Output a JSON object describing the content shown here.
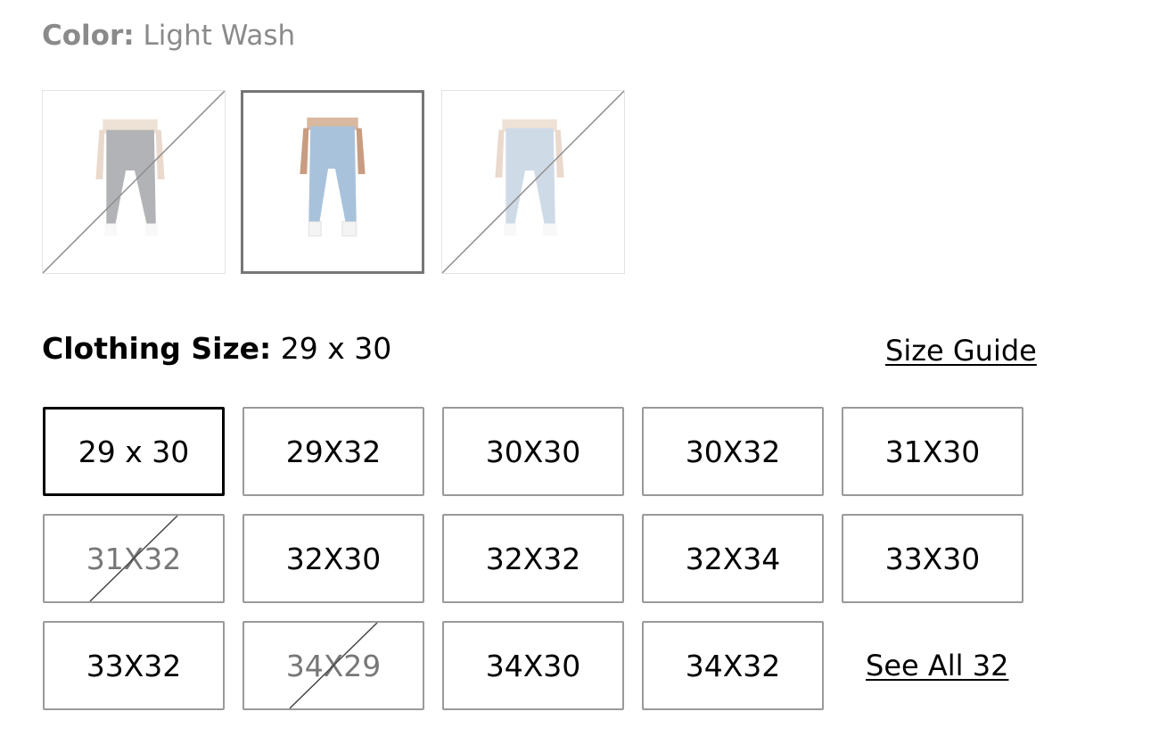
{
  "color": {
    "label": "Color:",
    "value": "Light Wash",
    "swatches": [
      {
        "name": "Dark Wash",
        "selected": false,
        "available": false,
        "denim": "#4a4d52"
      },
      {
        "name": "Light Wash",
        "selected": true,
        "available": true,
        "denim": "#a9c2dc"
      },
      {
        "name": "Medium Light Wash",
        "selected": false,
        "available": false,
        "denim": "#8fa9c8"
      }
    ]
  },
  "size": {
    "label": "Clothing Size:",
    "value": "29 x 30",
    "size_guide": "Size Guide",
    "see_all": "See All 32",
    "options": [
      {
        "label": "29 x 30",
        "selected": true,
        "available": true
      },
      {
        "label": "29X32",
        "selected": false,
        "available": true
      },
      {
        "label": "30X30",
        "selected": false,
        "available": true
      },
      {
        "label": "30X32",
        "selected": false,
        "available": true
      },
      {
        "label": "31X30",
        "selected": false,
        "available": true
      },
      {
        "label": "31X32",
        "selected": false,
        "available": false
      },
      {
        "label": "32X30",
        "selected": false,
        "available": true
      },
      {
        "label": "32X32",
        "selected": false,
        "available": true
      },
      {
        "label": "32X34",
        "selected": false,
        "available": true
      },
      {
        "label": "33X30",
        "selected": false,
        "available": true
      },
      {
        "label": "33X32",
        "selected": false,
        "available": true
      },
      {
        "label": "34X29",
        "selected": false,
        "available": false
      },
      {
        "label": "34X30",
        "selected": false,
        "available": true
      },
      {
        "label": "34X32",
        "selected": false,
        "available": true
      }
    ]
  }
}
